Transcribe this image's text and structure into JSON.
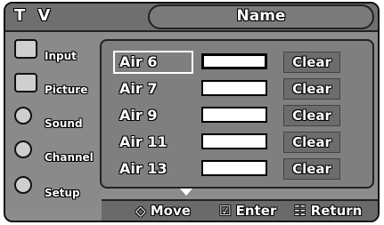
{
  "header": {
    "tv_label": "T V",
    "title": "Name"
  },
  "sidebar": {
    "items": [
      {
        "label": "Input",
        "icon": "input-icon"
      },
      {
        "label": "Picture",
        "icon": "picture-icon"
      },
      {
        "label": "Sound",
        "icon": "sound-icon"
      },
      {
        "label": "Channel",
        "icon": "channel-icon"
      },
      {
        "label": "Setup",
        "icon": "setup-icon"
      }
    ]
  },
  "list": {
    "rows": [
      {
        "name": "Air 6",
        "value": "",
        "button": "Clear"
      },
      {
        "name": "Air 7",
        "value": "",
        "button": "Clear"
      },
      {
        "name": "Air 9",
        "value": "",
        "button": "Clear"
      },
      {
        "name": "Air 11",
        "value": "",
        "button": "Clear"
      },
      {
        "name": "Air 13",
        "value": "",
        "button": "Clear"
      }
    ]
  },
  "footer": {
    "move": "◇ Move",
    "enter": "☑ Enter",
    "return": "☷ Return"
  }
}
